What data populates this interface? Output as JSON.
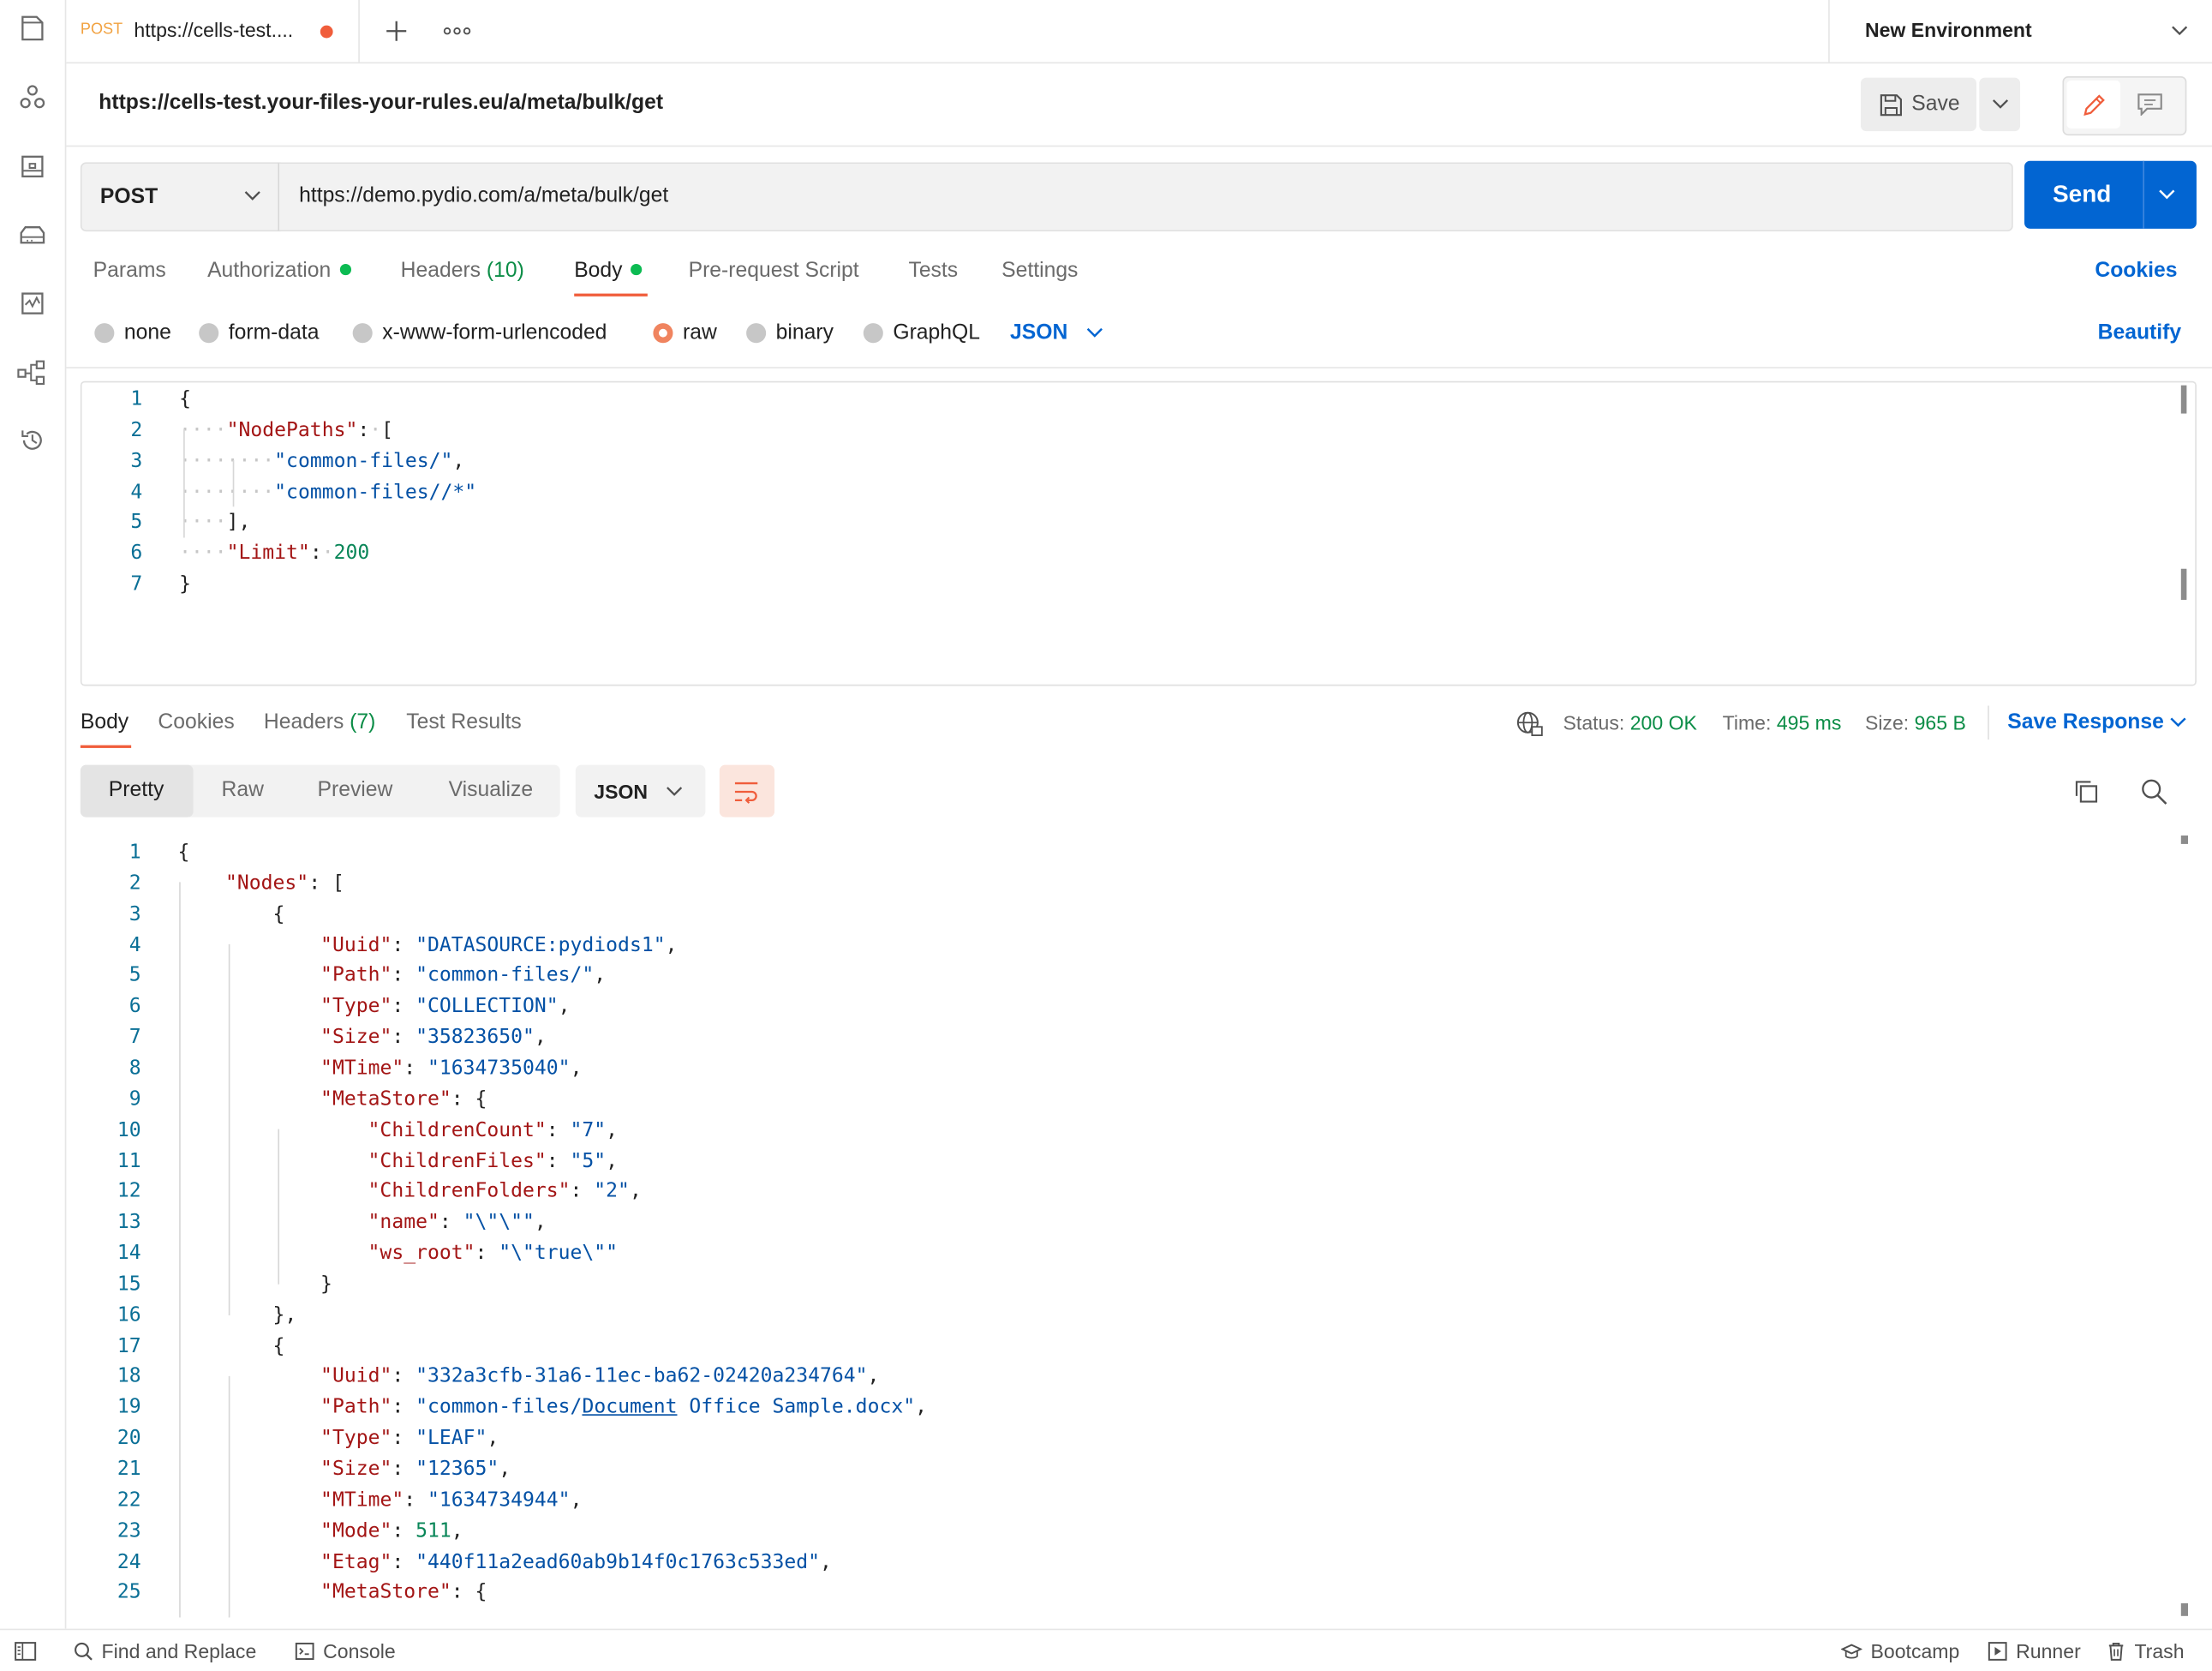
{
  "tab": {
    "method": "POST",
    "title": "https://cells-test...."
  },
  "environment": {
    "label": "New Environment"
  },
  "request": {
    "display_url": "https://cells-test.your-files-your-rules.eu/a/meta/bulk/get",
    "method": "POST",
    "url": "https://demo.pydio.com/a/meta/bulk/get",
    "save_label": "Save",
    "send_label": "Send"
  },
  "request_tabs": {
    "params": "Params",
    "authorization": "Authorization",
    "headers": "Headers",
    "headers_count": "(10)",
    "body": "Body",
    "prerequest": "Pre-request Script",
    "tests": "Tests",
    "settings": "Settings",
    "cookies": "Cookies"
  },
  "body_types": {
    "none": "none",
    "form_data": "form-data",
    "urlencoded": "x-www-form-urlencoded",
    "raw": "raw",
    "binary": "binary",
    "graphql": "GraphQL",
    "format": "JSON",
    "beautify": "Beautify",
    "selected": "raw"
  },
  "request_body_lines": [
    {
      "n": "1",
      "parts": [
        {
          "t": "{",
          "c": "pun"
        }
      ]
    },
    {
      "n": "2",
      "parts": [
        {
          "t": "····",
          "c": "ws"
        },
        {
          "t": "\"NodePaths\"",
          "c": "key"
        },
        {
          "t": ":",
          "c": "pun"
        },
        {
          "t": "·",
          "c": "ws"
        },
        {
          "t": "[",
          "c": "pun"
        }
      ]
    },
    {
      "n": "3",
      "parts": [
        {
          "t": "········",
          "c": "ws"
        },
        {
          "t": "\"common-files/\"",
          "c": "str"
        },
        {
          "t": ",",
          "c": "pun"
        }
      ]
    },
    {
      "n": "4",
      "parts": [
        {
          "t": "········",
          "c": "ws"
        },
        {
          "t": "\"common-files//*\"",
          "c": "str"
        }
      ]
    },
    {
      "n": "5",
      "parts": [
        {
          "t": "····",
          "c": "ws"
        },
        {
          "t": "],",
          "c": "pun"
        }
      ]
    },
    {
      "n": "6",
      "parts": [
        {
          "t": "····",
          "c": "ws"
        },
        {
          "t": "\"Limit\"",
          "c": "key"
        },
        {
          "t": ":",
          "c": "pun"
        },
        {
          "t": "·",
          "c": "ws"
        },
        {
          "t": "200",
          "c": "num"
        }
      ]
    },
    {
      "n": "7",
      "parts": [
        {
          "t": "}",
          "c": "pun"
        }
      ]
    }
  ],
  "response_tabs": {
    "body": "Body",
    "cookies": "Cookies",
    "headers": "Headers",
    "headers_count": "(7)",
    "test_results": "Test Results"
  },
  "response_status": {
    "status_label": "Status:",
    "status_value": "200 OK",
    "time_label": "Time:",
    "time_value": "495 ms",
    "size_label": "Size:",
    "size_value": "965 B",
    "save_response": "Save Response"
  },
  "response_view": {
    "pretty": "Pretty",
    "raw": "Raw",
    "preview": "Preview",
    "visualize": "Visualize",
    "format": "JSON"
  },
  "response_body_lines": [
    {
      "n": "1",
      "parts": [
        {
          "t": "{",
          "c": "pun"
        }
      ]
    },
    {
      "n": "2",
      "parts": [
        {
          "t": "    ",
          "c": "pun"
        },
        {
          "t": "\"Nodes\"",
          "c": "key"
        },
        {
          "t": ": [",
          "c": "pun"
        }
      ]
    },
    {
      "n": "3",
      "parts": [
        {
          "t": "        {",
          "c": "pun"
        }
      ]
    },
    {
      "n": "4",
      "parts": [
        {
          "t": "            ",
          "c": "pun"
        },
        {
          "t": "\"Uuid\"",
          "c": "key"
        },
        {
          "t": ": ",
          "c": "pun"
        },
        {
          "t": "\"DATASOURCE:pydiods1\"",
          "c": "str"
        },
        {
          "t": ",",
          "c": "pun"
        }
      ]
    },
    {
      "n": "5",
      "parts": [
        {
          "t": "            ",
          "c": "pun"
        },
        {
          "t": "\"Path\"",
          "c": "key"
        },
        {
          "t": ": ",
          "c": "pun"
        },
        {
          "t": "\"common-files/\"",
          "c": "str"
        },
        {
          "t": ",",
          "c": "pun"
        }
      ]
    },
    {
      "n": "6",
      "parts": [
        {
          "t": "            ",
          "c": "pun"
        },
        {
          "t": "\"Type\"",
          "c": "key"
        },
        {
          "t": ": ",
          "c": "pun"
        },
        {
          "t": "\"COLLECTION\"",
          "c": "str"
        },
        {
          "t": ",",
          "c": "pun"
        }
      ]
    },
    {
      "n": "7",
      "parts": [
        {
          "t": "            ",
          "c": "pun"
        },
        {
          "t": "\"Size\"",
          "c": "key"
        },
        {
          "t": ": ",
          "c": "pun"
        },
        {
          "t": "\"35823650\"",
          "c": "str"
        },
        {
          "t": ",",
          "c": "pun"
        }
      ]
    },
    {
      "n": "8",
      "parts": [
        {
          "t": "            ",
          "c": "pun"
        },
        {
          "t": "\"MTime\"",
          "c": "key"
        },
        {
          "t": ": ",
          "c": "pun"
        },
        {
          "t": "\"1634735040\"",
          "c": "str"
        },
        {
          "t": ",",
          "c": "pun"
        }
      ]
    },
    {
      "n": "9",
      "parts": [
        {
          "t": "            ",
          "c": "pun"
        },
        {
          "t": "\"MetaStore\"",
          "c": "key"
        },
        {
          "t": ": {",
          "c": "pun"
        }
      ]
    },
    {
      "n": "10",
      "parts": [
        {
          "t": "                ",
          "c": "pun"
        },
        {
          "t": "\"ChildrenCount\"",
          "c": "key"
        },
        {
          "t": ": ",
          "c": "pun"
        },
        {
          "t": "\"7\"",
          "c": "str"
        },
        {
          "t": ",",
          "c": "pun"
        }
      ]
    },
    {
      "n": "11",
      "parts": [
        {
          "t": "                ",
          "c": "pun"
        },
        {
          "t": "\"ChildrenFiles\"",
          "c": "key"
        },
        {
          "t": ": ",
          "c": "pun"
        },
        {
          "t": "\"5\"",
          "c": "str"
        },
        {
          "t": ",",
          "c": "pun"
        }
      ]
    },
    {
      "n": "12",
      "parts": [
        {
          "t": "                ",
          "c": "pun"
        },
        {
          "t": "\"ChildrenFolders\"",
          "c": "key"
        },
        {
          "t": ": ",
          "c": "pun"
        },
        {
          "t": "\"2\"",
          "c": "str"
        },
        {
          "t": ",",
          "c": "pun"
        }
      ]
    },
    {
      "n": "13",
      "parts": [
        {
          "t": "                ",
          "c": "pun"
        },
        {
          "t": "\"name\"",
          "c": "key"
        },
        {
          "t": ": ",
          "c": "pun"
        },
        {
          "t": "\"\\\"\\\"\"",
          "c": "str"
        },
        {
          "t": ",",
          "c": "pun"
        }
      ]
    },
    {
      "n": "14",
      "parts": [
        {
          "t": "                ",
          "c": "pun"
        },
        {
          "t": "\"ws_root\"",
          "c": "key"
        },
        {
          "t": ": ",
          "c": "pun"
        },
        {
          "t": "\"\\\"true\\\"\"",
          "c": "str"
        }
      ]
    },
    {
      "n": "15",
      "parts": [
        {
          "t": "            }",
          "c": "pun"
        }
      ]
    },
    {
      "n": "16",
      "parts": [
        {
          "t": "        },",
          "c": "pun"
        }
      ]
    },
    {
      "n": "17",
      "parts": [
        {
          "t": "        {",
          "c": "pun"
        }
      ]
    },
    {
      "n": "18",
      "parts": [
        {
          "t": "            ",
          "c": "pun"
        },
        {
          "t": "\"Uuid\"",
          "c": "key"
        },
        {
          "t": ": ",
          "c": "pun"
        },
        {
          "t": "\"332a3cfb-31a6-11ec-ba62-02420a234764\"",
          "c": "str"
        },
        {
          "t": ",",
          "c": "pun"
        }
      ]
    },
    {
      "n": "19",
      "parts": [
        {
          "t": "            ",
          "c": "pun"
        },
        {
          "t": "\"Path\"",
          "c": "key"
        },
        {
          "t": ": ",
          "c": "pun"
        },
        {
          "t": "\"common-files/",
          "c": "str"
        },
        {
          "t": "Document",
          "c": "str link"
        },
        {
          "t": " Office Sample.docx\"",
          "c": "str"
        },
        {
          "t": ",",
          "c": "pun"
        }
      ]
    },
    {
      "n": "20",
      "parts": [
        {
          "t": "            ",
          "c": "pun"
        },
        {
          "t": "\"Type\"",
          "c": "key"
        },
        {
          "t": ": ",
          "c": "pun"
        },
        {
          "t": "\"LEAF\"",
          "c": "str"
        },
        {
          "t": ",",
          "c": "pun"
        }
      ]
    },
    {
      "n": "21",
      "parts": [
        {
          "t": "            ",
          "c": "pun"
        },
        {
          "t": "\"Size\"",
          "c": "key"
        },
        {
          "t": ": ",
          "c": "pun"
        },
        {
          "t": "\"12365\"",
          "c": "str"
        },
        {
          "t": ",",
          "c": "pun"
        }
      ]
    },
    {
      "n": "22",
      "parts": [
        {
          "t": "            ",
          "c": "pun"
        },
        {
          "t": "\"MTime\"",
          "c": "key"
        },
        {
          "t": ": ",
          "c": "pun"
        },
        {
          "t": "\"1634734944\"",
          "c": "str"
        },
        {
          "t": ",",
          "c": "pun"
        }
      ]
    },
    {
      "n": "23",
      "parts": [
        {
          "t": "            ",
          "c": "pun"
        },
        {
          "t": "\"Mode\"",
          "c": "key"
        },
        {
          "t": ": ",
          "c": "pun"
        },
        {
          "t": "511",
          "c": "num"
        },
        {
          "t": ",",
          "c": "pun"
        }
      ]
    },
    {
      "n": "24",
      "parts": [
        {
          "t": "            ",
          "c": "pun"
        },
        {
          "t": "\"Etag\"",
          "c": "key"
        },
        {
          "t": ": ",
          "c": "pun"
        },
        {
          "t": "\"440f11a2ead60ab9b14f0c1763c533ed\"",
          "c": "str"
        },
        {
          "t": ",",
          "c": "pun"
        }
      ]
    },
    {
      "n": "25",
      "parts": [
        {
          "t": "            ",
          "c": "pun"
        },
        {
          "t": "\"MetaStore\"",
          "c": "key"
        },
        {
          "t": ": {",
          "c": "pun"
        }
      ]
    }
  ],
  "status_bar": {
    "find_replace": "Find and Replace",
    "console": "Console",
    "bootcamp": "Bootcamp",
    "runner": "Runner",
    "trash": "Trash"
  },
  "icons": {
    "rail": [
      "collections-icon",
      "apis-icon",
      "environments-icon",
      "mock-servers-icon",
      "monitors-icon",
      "flows-icon",
      "history-icon"
    ]
  },
  "colors": {
    "accent": "#0265d2",
    "method_post": "#f1a13f",
    "unsaved_dot": "#f05d3b",
    "active_underline": "#f05d3b",
    "status_ok": "#0c8d47",
    "json_key": "#a31515",
    "json_string": "#0451a5",
    "json_number": "#098658"
  }
}
